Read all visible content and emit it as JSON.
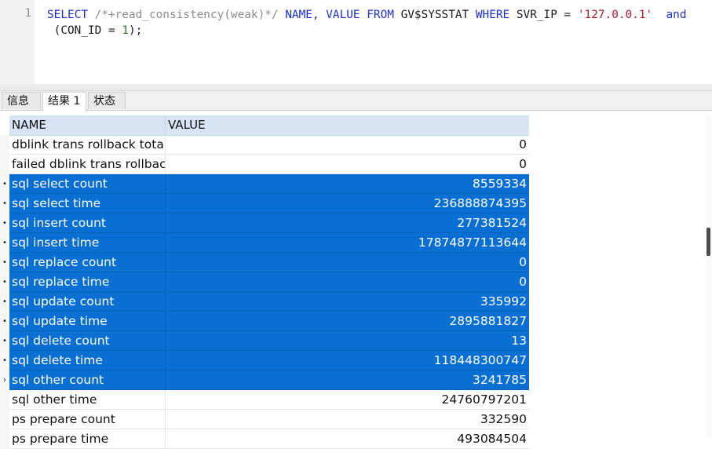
{
  "editor": {
    "line_number": "1",
    "sql": {
      "select": "SELECT",
      "comment": "/*+read_consistency(weak)*/",
      "cols": "NAME, VALUE",
      "from": "FROM",
      "table": "GV$SYSSTAT",
      "where": "WHERE",
      "cond1": "SVR_IP =",
      "ip": "'127.0.0.1'",
      "and": "and",
      "cond2_open": "(CON_ID =",
      "con_id": "1",
      "cond2_close": ");"
    }
  },
  "tabs": [
    "信息",
    "结果 1",
    "状态"
  ],
  "grid": {
    "columns": [
      "NAME",
      "VALUE"
    ],
    "rows": [
      {
        "name": "dblink trans rollback total u",
        "value": "0",
        "selected": false,
        "marker": ""
      },
      {
        "name": "failed dblink trans rollback",
        "value": "0",
        "selected": false,
        "marker": ""
      },
      {
        "name": "sql select count",
        "value": "8559334",
        "selected": true,
        "marker": "•"
      },
      {
        "name": "sql select time",
        "value": "236888874395",
        "selected": true,
        "marker": "•"
      },
      {
        "name": "sql insert count",
        "value": "277381524",
        "selected": true,
        "marker": "•"
      },
      {
        "name": "sql insert time",
        "value": "17874877113644",
        "selected": true,
        "marker": "•"
      },
      {
        "name": "sql replace count",
        "value": "0",
        "selected": true,
        "marker": "•"
      },
      {
        "name": "sql replace time",
        "value": "0",
        "selected": true,
        "marker": "•"
      },
      {
        "name": "sql update count",
        "value": "335992",
        "selected": true,
        "marker": "•"
      },
      {
        "name": "sql update time",
        "value": "2895881827",
        "selected": true,
        "marker": "•"
      },
      {
        "name": "sql delete count",
        "value": "13",
        "selected": true,
        "marker": "•"
      },
      {
        "name": "sql delete time",
        "value": "118448300747",
        "selected": true,
        "marker": "•"
      },
      {
        "name": "sql other count",
        "value": "3241785",
        "selected": true,
        "marker": "›"
      },
      {
        "name": "sql other time",
        "value": "24760797201",
        "selected": false,
        "marker": ""
      },
      {
        "name": "ps prepare count",
        "value": "332590",
        "selected": false,
        "marker": ""
      },
      {
        "name": "ps prepare time",
        "value": "493084504",
        "selected": false,
        "marker": ""
      }
    ]
  },
  "colors": {
    "selection": "#0a6fd2",
    "header": "#d6e4f4",
    "keyword": "#1c2fd6",
    "string": "#b0182a",
    "number": "#1c7d1c",
    "comment": "#8b8b8b"
  }
}
